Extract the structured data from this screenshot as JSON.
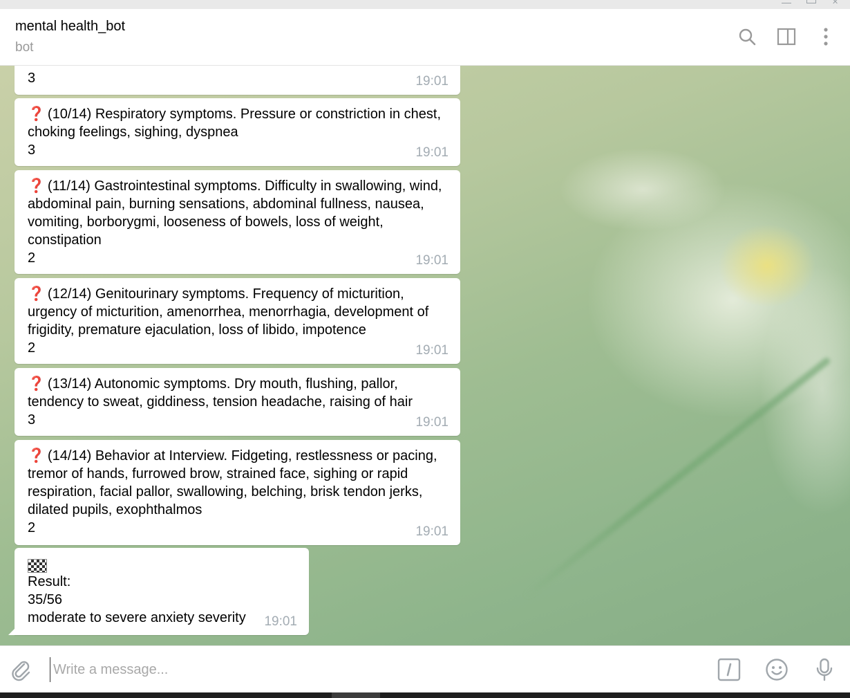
{
  "header": {
    "chat_name": "mental health_bot",
    "chat_status": "bot",
    "icons": [
      "search-icon",
      "sidebar-toggle-icon",
      "more-vertical-icon"
    ]
  },
  "messages": [
    {
      "text": "3",
      "time": "19:01",
      "question_icon": false
    },
    {
      "text": "(10/14) Respiratory symptoms. Pressure or constriction in chest, choking feelings, sighing, dyspnea\n3",
      "time": "19:01",
      "question_icon": true
    },
    {
      "text": "(11/14) Gastrointestinal symptoms. Difficulty in swallowing, wind, abdominal pain, burning sensations, abdominal fullness, nausea, vomiting, borborygmi, looseness of bowels, loss of weight, constipation\n2",
      "time": "19:01",
      "question_icon": true
    },
    {
      "text": "(12/14) Genitourinary symptoms. Frequency of micturition, urgency of micturition, amenorrhea, menorrhagia, development of frigidity, premature ejaculation, loss of libido, impotence\n2",
      "time": "19:01",
      "question_icon": true
    },
    {
      "text": "(13/14) Autonomic symptoms. Dry mouth, flushing, pallor, tendency to sweat, giddiness, tension headache, raising of hair\n3",
      "time": "19:01",
      "question_icon": true
    },
    {
      "text": "(14/14) Behavior at Interview. Fidgeting, restlessness or pacing, tremor of hands, furrowed brow, strained face, sighing or rapid respiration, facial pallor, swallowing, belching, brisk tendon jerks, dilated pupils, exophthalmos\n2",
      "time": "19:01",
      "question_icon": true
    },
    {
      "text": "Result:\n35/56\nmoderate to severe anxiety severity",
      "time": "19:01",
      "question_icon": false,
      "icon": "checkered-flag-icon"
    }
  ],
  "question_glyph": "❓",
  "composer": {
    "placeholder": "Write a message...",
    "icons": [
      "attach-icon",
      "bot-commands-icon",
      "emoji-icon",
      "microphone-icon"
    ]
  },
  "colors": {
    "accent_question": "#d9191f",
    "time": "#a3acb3",
    "bubble": "#ffffff"
  }
}
